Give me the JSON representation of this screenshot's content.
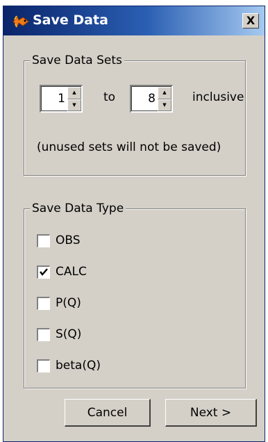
{
  "window": {
    "title": "Save Data",
    "close_glyph": "X"
  },
  "save_data_sets": {
    "label": "Save Data Sets",
    "from_value": "1",
    "to_label": "to",
    "to_value": "8",
    "inclusive_label": "inclusive",
    "note": "(unused sets will not be saved)"
  },
  "save_data_type": {
    "label": "Save Data Type",
    "options": [
      {
        "label": "OBS",
        "checked": false
      },
      {
        "label": "CALC",
        "checked": true
      },
      {
        "label": "P(Q)",
        "checked": false
      },
      {
        "label": "S(Q)",
        "checked": false
      },
      {
        "label": "beta(Q)",
        "checked": false
      }
    ]
  },
  "buttons": {
    "cancel": "Cancel",
    "next": "Next >"
  },
  "colors": {
    "titlebar_start": "#0a246a",
    "titlebar_end": "#a6caf0",
    "dialog_bg": "#d4d0c8"
  },
  "icons": {
    "title": "fish-icon",
    "close": "close-icon",
    "spin_up": "spin-up-arrow-icon",
    "spin_down": "spin-down-arrow-icon",
    "check": "check-mark-icon"
  }
}
